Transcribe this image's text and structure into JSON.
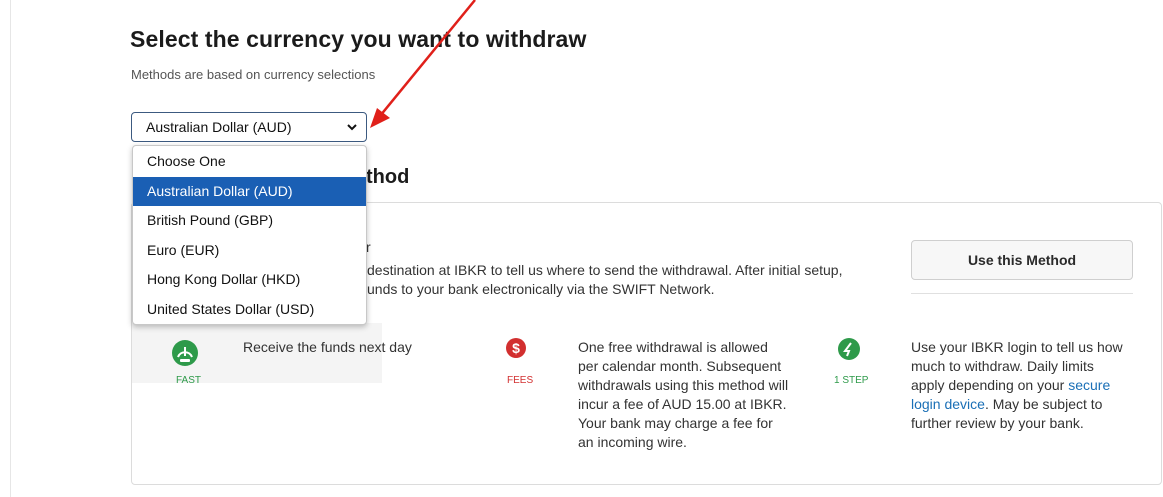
{
  "page": {
    "title": "Select the currency you want to withdraw",
    "subtitle": "Methods are based on currency selections"
  },
  "currency_select": {
    "selected": "Australian Dollar (AUD)",
    "options": [
      "Choose One",
      "Australian Dollar (AUD)",
      "British Pound (GBP)",
      "Euro (EUR)",
      "Hong Kong Dollar (HKD)",
      "United States Dollar (USD)"
    ]
  },
  "method_section": {
    "heading_fragment": "thod",
    "card": {
      "name_fragment": "r",
      "desc_line1": "destination at IBKR to tell us where to send the withdrawal. After initial setup,",
      "desc_line2": "unds to your bank electronically via the SWIFT Network.",
      "use_button": "Use this Method",
      "features": {
        "fast": {
          "label": "FAST",
          "text": "Receive the funds next day"
        },
        "fees": {
          "label": "FEES",
          "lines": [
            "One free withdrawal is allowed",
            "per calendar month. Subsequent",
            "withdrawals using this method will",
            "incur a fee of AUD 15.00 at IBKR.",
            "Your bank may charge a fee for",
            "an incoming wire."
          ]
        },
        "step": {
          "label": "1 STEP",
          "line1": "Use your IBKR login to tell us how",
          "line2": "much to withdraw. Daily limits",
          "line3_text": "apply depending on your ",
          "line3_link": "secure",
          "line4_link": "login device",
          "line4_text": ". May be subject to",
          "line5": "further review by your bank."
        }
      }
    }
  },
  "colors": {
    "accent_blue": "#1a5fb4",
    "fast_green": "#2e9a4a",
    "fees_red": "#d22f2f",
    "annotation_arrow": "#e0201a"
  }
}
